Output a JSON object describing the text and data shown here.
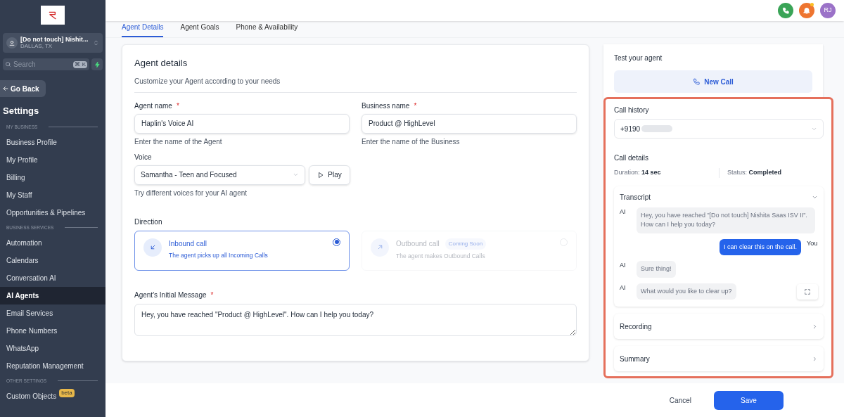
{
  "sidebar": {
    "account": {
      "name": "[Do not touch] Nishit...",
      "location": "DALLAS, TX"
    },
    "search": {
      "placeholder": "Search",
      "shortcut": "⌘ K"
    },
    "go_back": "Go Back",
    "title": "Settings",
    "sections": [
      {
        "heading": "MY BUSINESS",
        "items": [
          {
            "label": "Business Profile",
            "selected": false
          },
          {
            "label": "My Profile",
            "selected": false
          },
          {
            "label": "Billing",
            "selected": false
          },
          {
            "label": "My Staff",
            "selected": false
          },
          {
            "label": "Opportunities & Pipelines",
            "selected": false
          }
        ]
      },
      {
        "heading": "BUSINESS SERVICES",
        "items": [
          {
            "label": "Automation",
            "selected": false
          },
          {
            "label": "Calendars",
            "selected": false
          },
          {
            "label": "Conversation AI",
            "selected": false
          },
          {
            "label": "AI Agents",
            "selected": true
          },
          {
            "label": "Email Services",
            "selected": false
          },
          {
            "label": "Phone Numbers",
            "selected": false
          },
          {
            "label": "WhatsApp",
            "selected": false
          },
          {
            "label": "Reputation Management",
            "selected": false
          }
        ]
      },
      {
        "heading": "OTHER SETTINGS",
        "items": [
          {
            "label": "Custom Objects",
            "selected": false,
            "badge": "beta"
          }
        ]
      }
    ]
  },
  "top_bar": {
    "avatar": "RJ",
    "notification": true
  },
  "tabs": [
    {
      "label": "Agent Details",
      "selected": true
    },
    {
      "label": "Agent Goals",
      "selected": false
    },
    {
      "label": "Phone & Availability",
      "selected": false
    }
  ],
  "agent_details": {
    "title": "Agent details",
    "subtitle": "Customize your Agent according to your needs",
    "fields": [
      {
        "label": "Agent name",
        "required_mark": "*",
        "value": "Haplin's Voice AI",
        "hint": "Enter the name of the Agent"
      },
      {
        "label": "Business name",
        "required_mark": "*",
        "value": "Product @ HighLevel",
        "hint": "Enter the name of the Business"
      }
    ],
    "voice": {
      "label": "Voice",
      "value": "Samantha - Teen and Focused",
      "play": "Play",
      "hint": "Try different voices for your AI agent"
    },
    "direction": {
      "label": "Direction",
      "options": [
        {
          "kind": "inbound",
          "title": "Inbound call",
          "description": "The agent picks up all Incoming Calls",
          "selected": true,
          "disabled": false
        },
        {
          "kind": "outbound",
          "title": "Outbound call",
          "badge": "Coming Soon",
          "description": "The agent makes Outbound Calls",
          "selected": false,
          "disabled": true
        }
      ]
    },
    "initial_message": {
      "label": "Agent's Initial Message",
      "required_mark": "*",
      "value": "Hey, you have reached \"Product @ HighLevel\". How can I help you today?"
    }
  },
  "test_panel": {
    "title": "Test your agent",
    "new_call": "New Call",
    "call_history": {
      "label": "Call history",
      "value": "+9190"
    },
    "call_details": {
      "title": "Call details",
      "duration_label": "Duration:",
      "duration": "14 sec",
      "status_label": "Status:",
      "status": "Completed"
    },
    "transcript": {
      "title": "Transcript",
      "expanded": true,
      "messages": [
        {
          "kind": "ai",
          "speaker": "AI",
          "text": "Hey, you have reached \"[Do not touch] Nishita Saas ISV II\". How can I help you today?"
        },
        {
          "kind": "user",
          "speaker": "You",
          "text": "I can clear this on the call."
        },
        {
          "kind": "ai",
          "speaker": "AI",
          "text": "Sure thing!"
        },
        {
          "kind": "ai",
          "speaker": "AI",
          "text": "What would you like to clear up?"
        }
      ]
    },
    "sections": [
      {
        "title": "Recording",
        "expanded": false
      },
      {
        "title": "Summary",
        "expanded": false
      }
    ]
  },
  "footer": {
    "cancel": "Cancel",
    "save": "Save"
  }
}
